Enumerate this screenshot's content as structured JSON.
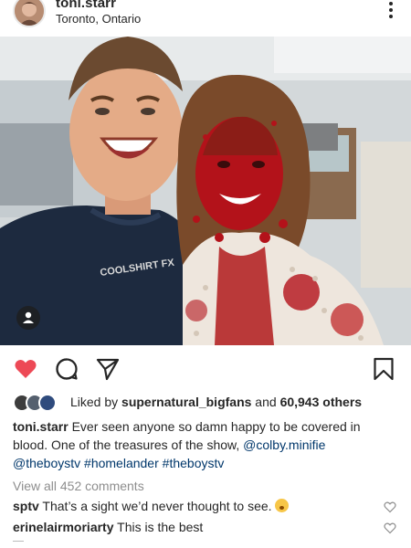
{
  "post": {
    "username": "toni.starr",
    "location": "Toronto, Ontario"
  },
  "photo": {
    "shirt_text": "COOLSHIRT FX",
    "colors": {
      "wall": "#cfd5d8",
      "blood": "#b3121a",
      "shirt": "#1d2a3f"
    }
  },
  "likes": {
    "prefix": "Liked by ",
    "user": "supernatural_bigfans",
    "middle": " and ",
    "count": "60,943 others"
  },
  "caption": {
    "username": "toni.starr",
    "text": " Ever seen anyone so damn happy to be covered in blood. One of the treasures of the show, ",
    "mention1": "@colby.minifie",
    "mention2": "@theboystv",
    "tag1": "#homelander",
    "tag2": "#theboystv"
  },
  "comments": {
    "view_all": "View all 452 comments",
    "items": [
      {
        "user": "sptv",
        "text": " That’s a sight we’d never thought to see. "
      },
      {
        "user": "erinelairmoriarty",
        "text": " This is the best"
      }
    ]
  },
  "icons": {
    "like": "heart-icon",
    "comment": "comment-icon",
    "share": "send-icon",
    "save": "bookmark-icon",
    "more": "more-icon",
    "tag": "user-tag-icon"
  },
  "accent": {
    "heart": "#ed4956",
    "link": "#00376b",
    "muted": "#8e8e8e"
  }
}
